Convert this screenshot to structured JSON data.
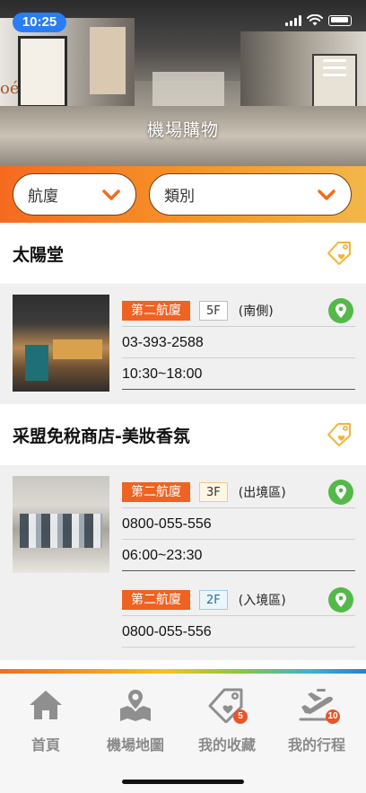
{
  "status_bar": {
    "time": "10:25"
  },
  "header": {
    "title": "機場購物",
    "hero_sign_text": "oé"
  },
  "filters": {
    "terminal": "航廈",
    "category": "類別"
  },
  "stores": [
    {
      "name": "太陽堂",
      "locations": [
        {
          "terminal": "第二航廈",
          "floor": "5F",
          "area": "(南側)",
          "phone": "03-393-2588",
          "hours": "10:30~18:00"
        }
      ]
    },
    {
      "name": "采盟免稅商店-美妝香氛",
      "locations": [
        {
          "terminal": "第二航廈",
          "floor": "3F",
          "area": "(出境區)",
          "phone": "0800-055-556",
          "hours": "06:00~23:30"
        },
        {
          "terminal": "第二航廈",
          "floor": "2F",
          "area": "(入境區)",
          "phone": "0800-055-556",
          "hours": ""
        }
      ]
    }
  ],
  "tabbar": {
    "items": [
      {
        "label": "首頁",
        "icon": "home-icon"
      },
      {
        "label": "機場地圖",
        "icon": "map-icon"
      },
      {
        "label": "我的收藏",
        "icon": "favorite-tag-icon",
        "badge": "5"
      },
      {
        "label": "我的行程",
        "icon": "flight-icon",
        "badge": "10"
      }
    ]
  },
  "colors": {
    "accent_orange": "#f26b21",
    "pin_green": "#54b948",
    "time_pill_blue": "#2a7ef5"
  }
}
